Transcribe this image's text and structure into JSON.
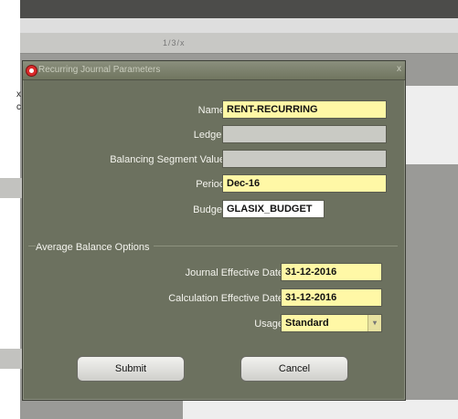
{
  "toolbar": {
    "hint": "1/3/x"
  },
  "dialog": {
    "title": "Recurring Journal Parameters",
    "close_label": "x"
  },
  "form": {
    "name": {
      "label": "Name",
      "value": "RENT-RECURRING"
    },
    "ledger": {
      "label": "Ledger",
      "value": ""
    },
    "balancing_segment": {
      "label": "Balancing Segment Value",
      "value": ""
    },
    "period": {
      "label": "Period",
      "value": "Dec-16"
    },
    "budget": {
      "label": "Budget",
      "value": "GLASIX_BUDGET"
    }
  },
  "average_balance": {
    "title": "Average Balance Options",
    "journal_effective_date": {
      "label": "Journal Effective Date",
      "value": "31-12-2016"
    },
    "calculation_effective_date": {
      "label": "Calculation Effective Date",
      "value": "31-12-2016"
    },
    "usage": {
      "label": "Usage",
      "value": "Standard"
    }
  },
  "buttons": {
    "submit": "Submit",
    "cancel": "Cancel"
  },
  "colors": {
    "dialog_bg": "#6c715f",
    "required_field": "#fff8a6",
    "disabled_field": "#c9cac4"
  },
  "left_edge": {
    "tick1": "x",
    "tick2": "c"
  }
}
